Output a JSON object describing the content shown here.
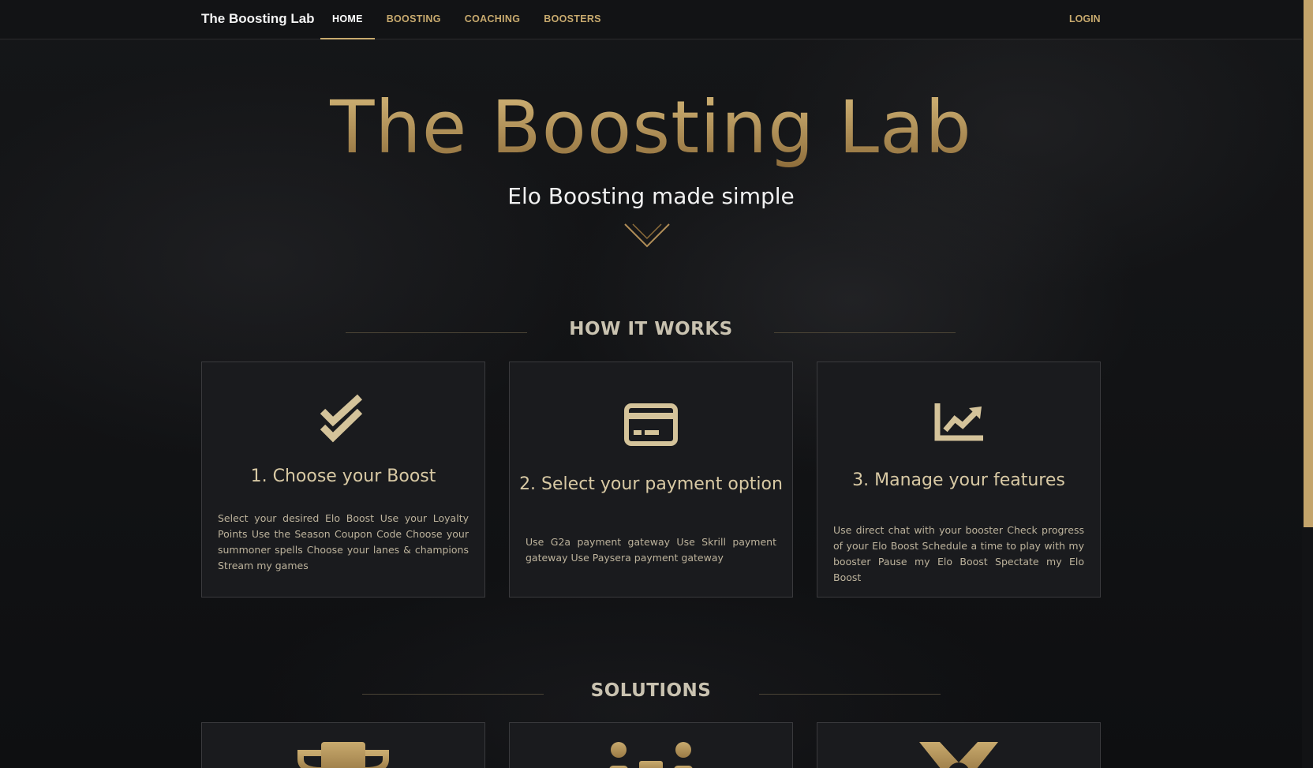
{
  "nav": {
    "brand": "The Boosting Lab",
    "links": [
      {
        "label": "HOME",
        "active": true
      },
      {
        "label": "BOOSTING",
        "active": false
      },
      {
        "label": "COACHING",
        "active": false
      },
      {
        "label": "BOOSTERS",
        "active": false
      }
    ],
    "login": "LOGIN"
  },
  "hero": {
    "title": "The Boosting Lab",
    "subtitle": "Elo Boosting made simple"
  },
  "how_it_works": {
    "heading": "HOW IT WORKS",
    "steps": [
      {
        "icon": "double-check-icon",
        "title": "1. Choose your Boost",
        "text": "Select your desired Elo Boost Use your Loyalty Points Use the Season Coupon Code Choose your summoner spells Choose your lanes & champions Stream my games"
      },
      {
        "icon": "credit-card-icon",
        "title": "2. Select your payment option",
        "text": "Use G2a payment gateway Use Skrill payment gateway Use Paysera payment gateway"
      },
      {
        "icon": "chart-line-icon",
        "title": "3. Manage your features",
        "text": "Use direct chat with your booster Check progress of your Elo Boost Schedule a time to play with my booster Pause my Elo Boost Spectate my Elo Boost"
      }
    ]
  },
  "solutions": {
    "heading": "SOLUTIONS",
    "icons": [
      "trophy-icon",
      "users-icon",
      "medal-icon"
    ]
  },
  "colors": {
    "gold": "#c8aa6e",
    "gold_dark": "#8d6c3a",
    "card_bg": "#1a1b1e",
    "nav_bg": "#121315"
  }
}
